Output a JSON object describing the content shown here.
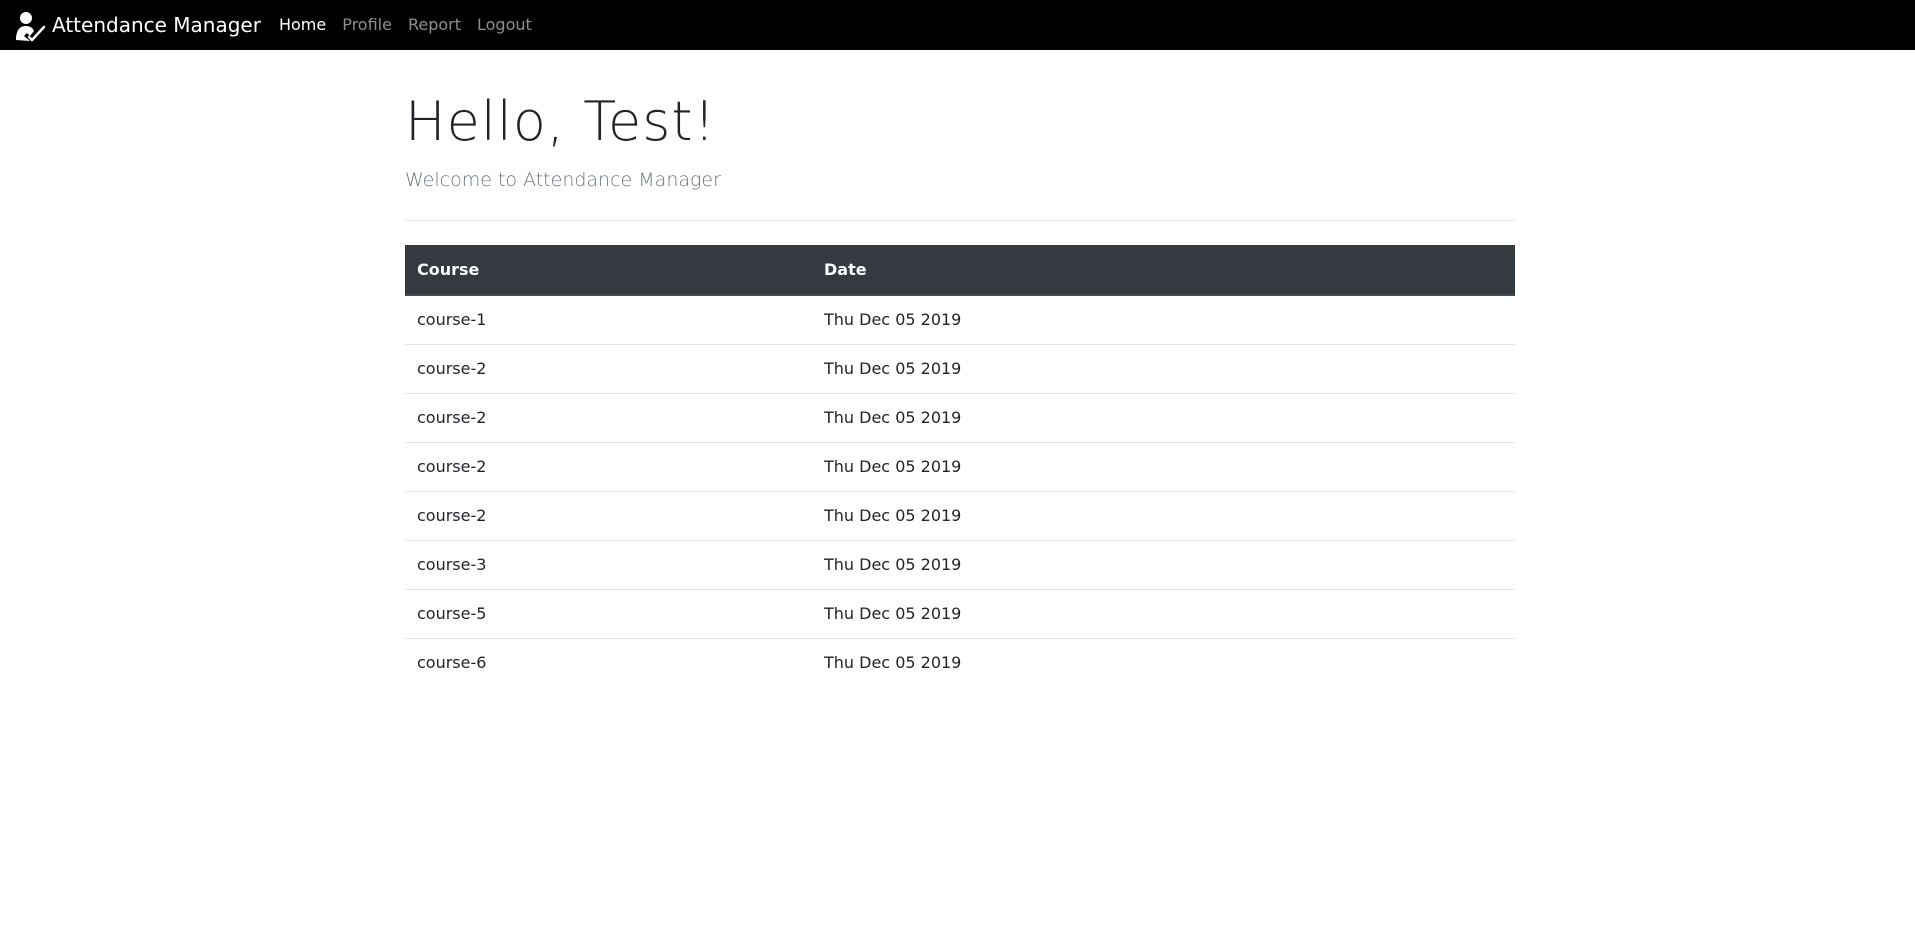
{
  "navbar": {
    "brand": "Attendance Manager",
    "brand_icon": "user-check-icon",
    "links": [
      "Home",
      "Profile",
      "Report",
      "Logout"
    ],
    "active_link": "Home"
  },
  "main": {
    "title": "Hello, Test!",
    "subtitle": "Welcome to Attendance Manager"
  },
  "table": {
    "headers": [
      "Course",
      "Date"
    ],
    "rows": [
      [
        "course-1",
        "Thu Dec 05 2019"
      ],
      [
        "course-2",
        "Thu Dec 05 2019"
      ],
      [
        "course-2",
        "Thu Dec 05 2019"
      ],
      [
        "course-2",
        "Thu Dec 05 2019"
      ],
      [
        "course-2",
        "Thu Dec 05 2019"
      ],
      [
        "course-3",
        "Thu Dec 05 2019"
      ],
      [
        "course-5",
        "Thu Dec 05 2019"
      ],
      [
        "course-6",
        "Thu Dec 05 2019"
      ]
    ]
  },
  "colors": {
    "navbar_bg": "#000000",
    "table_header_bg": "#343a40",
    "muted_text": "#6c757d"
  }
}
